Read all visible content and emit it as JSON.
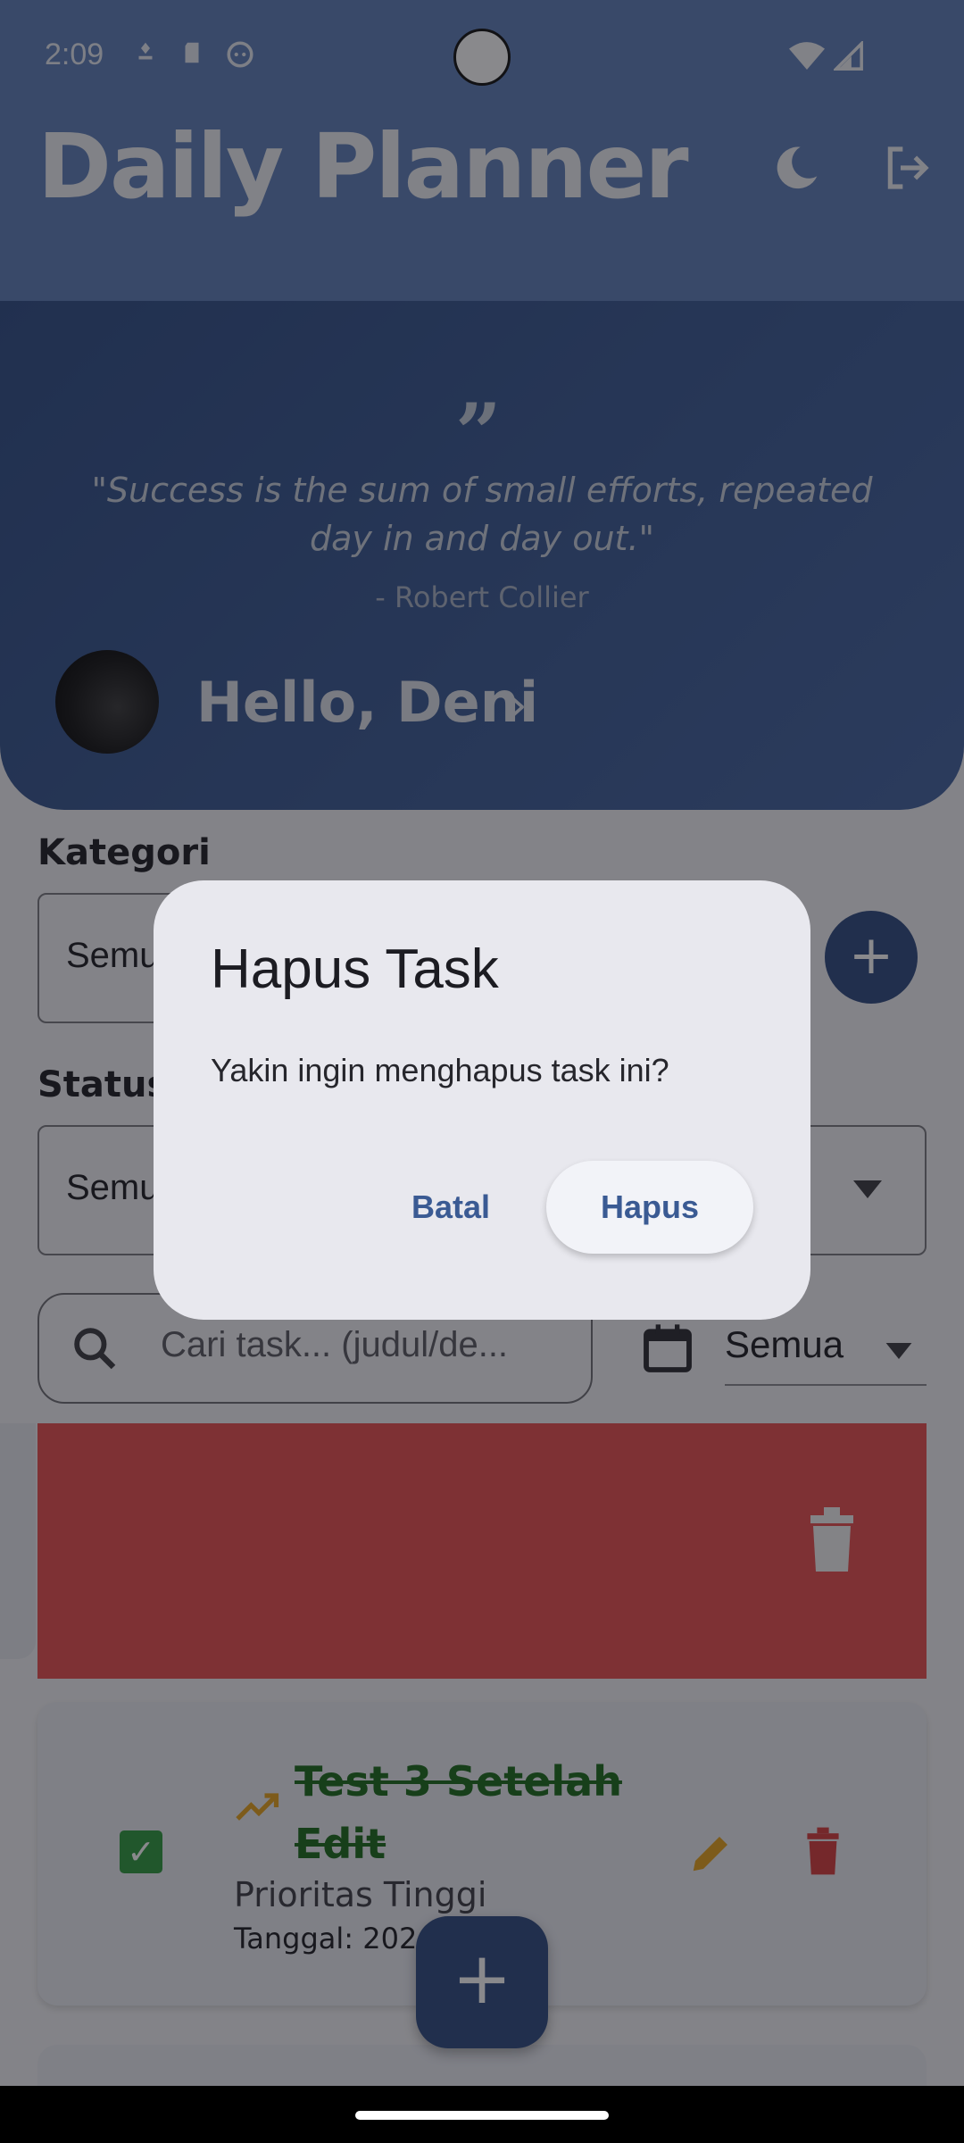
{
  "status_bar": {
    "time": "2:09"
  },
  "app_bar": {
    "title": "Daily Planner"
  },
  "quote": {
    "mark": "”",
    "text": "\"Success is the sum of small efforts, repeated day in and day out.\"",
    "author": "- Robert Collier"
  },
  "user": {
    "greeting": "Hello, Deni",
    "chevron": "›"
  },
  "filters": {
    "category_label": "Kategori",
    "category_value": "Semua",
    "status_label": "Status",
    "status_value": "Semua",
    "add_category": "+",
    "search_placeholder": "Cari task... (judul/de...",
    "date_filter_value": "Semua"
  },
  "task": {
    "check": "✓",
    "title": "Test 3 Setelah Edit",
    "priority": "Prioritas Tinggi",
    "date": "Tanggal: 202"
  },
  "fab": {
    "label": "+"
  },
  "dialog": {
    "title": "Hapus Task",
    "message": "Yakin ingin menghapus task ini?",
    "cancel_label": "Batal",
    "confirm_label": "Hapus"
  },
  "colors": {
    "primary": "#2e4a80",
    "app_bar": "#5f7fb9",
    "delete": "#e94f4f",
    "done": "#2e9a3e",
    "edit": "#e7a31c"
  }
}
